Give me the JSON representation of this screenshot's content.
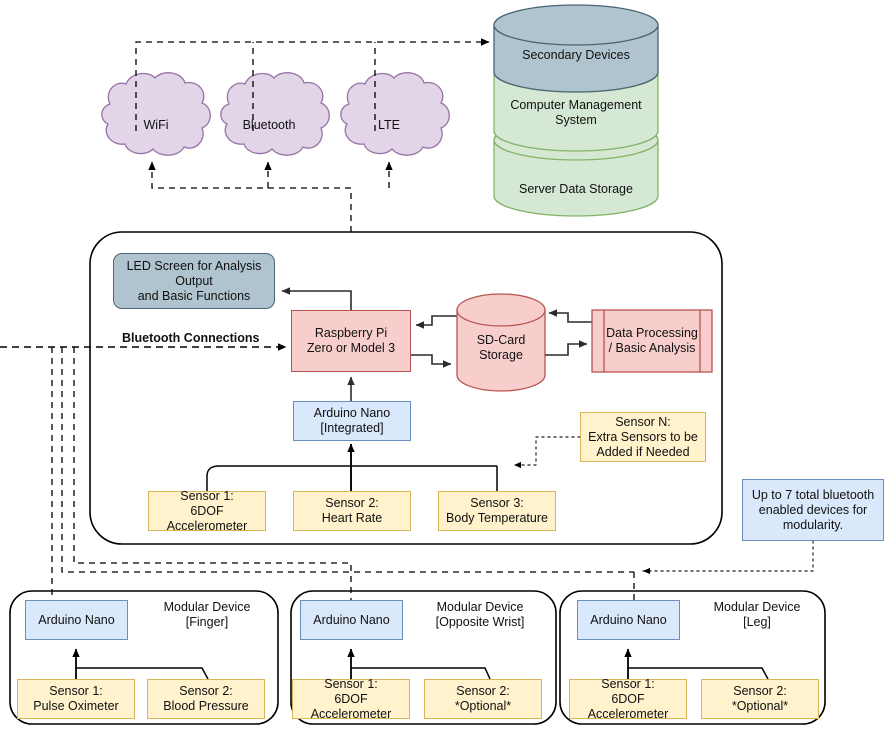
{
  "diagram": {
    "title": "Wearable Modular Sensor System Architecture",
    "colors": {
      "cloud_fill": "#e1d5e7",
      "cloud_stroke": "#9673a6",
      "blue_fill": "#dae8fc",
      "blue_stroke": "#6c8ebf",
      "red_fill": "#f8cecc",
      "red_stroke": "#b85450",
      "yellow_fill": "#fff2cc",
      "yellow_stroke": "#d6b656",
      "green_fill": "#d5e8d4",
      "green_stroke": "#82b366",
      "gray_blue_fill": "#b0c4cf",
      "gray_blue_stroke": "#4a6572",
      "line": "#000000"
    }
  },
  "clouds": [
    {
      "label": "WiFi"
    },
    {
      "label": "Bluetooth"
    },
    {
      "label": "LTE"
    }
  ],
  "server_stack": [
    {
      "label": "Secondary Devices",
      "fill": "#b0c4cf",
      "stroke": "#4a6572"
    },
    {
      "label": "Computer Management\nSystem",
      "fill": "#d5e8d4",
      "stroke": "#82b366"
    },
    {
      "label": "Server Data Storage",
      "fill": "#d5e8d4",
      "stroke": "#82b366"
    }
  ],
  "main_panel": {
    "led_screen": "LED Screen for Analysis Output\nand Basic Functions",
    "bluetooth_label": "Bluetooth Connections",
    "raspberry_pi": "Raspberry Pi\nZero or Model 3",
    "sd_card": "SD-Card\nStorage",
    "data_processing": "Data Processing\n/ Basic Analysis",
    "arduino_nano": "Arduino Nano\n[Integrated]",
    "sensor_n": "Sensor N:\nExtra Sensors to be\nAdded if Needed",
    "sensors": [
      "Sensor 1:\n6DOF Accelerometer",
      "Sensor 2:\nHeart Rate",
      "Sensor 3:\nBody Temperature"
    ]
  },
  "note": "Up to 7 total bluetooth\nenabled devices for\nmodularity.",
  "modular_devices": [
    {
      "title": "Modular Device\n[Finger]",
      "controller": "Arduino Nano",
      "sensors": [
        "Sensor 1:\nPulse Oximeter",
        "Sensor 2:\nBlood Pressure"
      ]
    },
    {
      "title": "Modular Device\n[Opposite Wrist]",
      "controller": "Arduino Nano",
      "sensors": [
        "Sensor 1:\n6DOF Accelerometer",
        "Sensor 2:\n*Optional*"
      ]
    },
    {
      "title": "Modular Device\n[Leg]",
      "controller": "Arduino Nano",
      "sensors": [
        "Sensor 1:\n6DOF Accelerometer",
        "Sensor 2:\n*Optional*"
      ]
    }
  ]
}
